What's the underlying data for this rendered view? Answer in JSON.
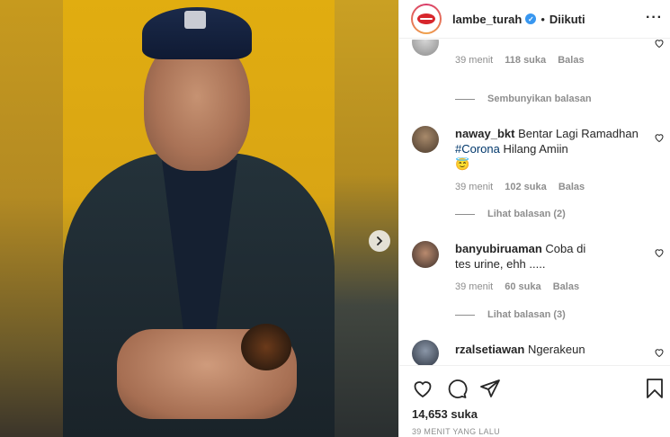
{
  "post": {
    "username": "lambe_turah",
    "follow_label": "Diikuti",
    "separator": "•",
    "more_label": "···",
    "likes": "14,653 suka",
    "timestamp": "39 MENIT YANG LALU",
    "verified_mark": "✓"
  },
  "comments": [
    {
      "user": "",
      "text": "",
      "time": "39 menit",
      "likes": "118 suka",
      "reply": "Balas",
      "replies_label": "Sembunyikan balasan"
    },
    {
      "user": "naway_bkt",
      "text_before": "Bentar Lagi Ramadhan ",
      "tag": "#Corona",
      "text_after": " Hilang Amiin",
      "emoji": "😇",
      "time": "39 menit",
      "likes": "102 suka",
      "reply": "Balas",
      "replies_label": "Lihat balasan (2)"
    },
    {
      "user": "banyubiruaman",
      "text": "Coba di tes urine, ehh .....",
      "time": "39 menit",
      "likes": "60 suka",
      "reply": "Balas",
      "replies_label": "Lihat balasan (3)"
    },
    {
      "user": "rzalsetiawan",
      "text": "Ngerakeun"
    }
  ],
  "icons": {
    "next": "chevron-right-icon",
    "like": "heart-icon",
    "comment": "comment-icon",
    "share": "share-icon",
    "save": "bookmark-icon"
  },
  "colors": {
    "verified": "#3897f0",
    "tag": "#00376b",
    "muted": "#8e8e8e"
  }
}
